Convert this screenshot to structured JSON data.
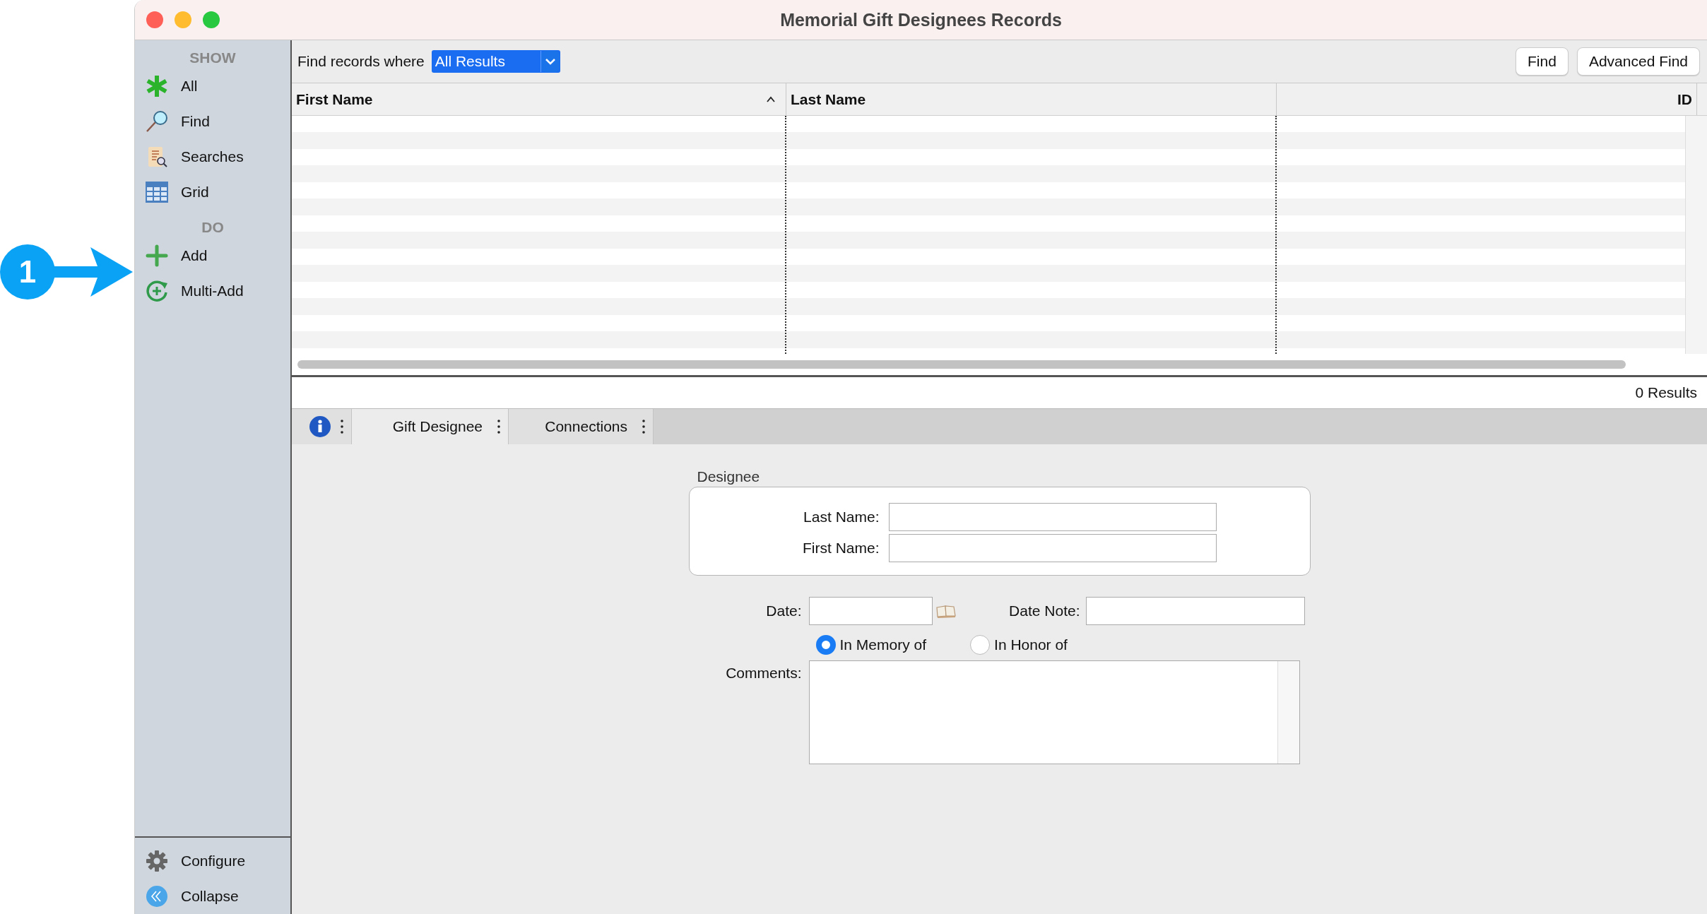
{
  "annotation": {
    "number": "1"
  },
  "window": {
    "title": "Memorial Gift Designees Records"
  },
  "sidebar": {
    "sections": [
      {
        "heading": "SHOW",
        "items": [
          {
            "label": "All",
            "kind": "asterisk"
          },
          {
            "label": "Find",
            "kind": "magnifier"
          },
          {
            "label": "Searches",
            "kind": "scroll"
          },
          {
            "label": "Grid",
            "kind": "grid"
          }
        ]
      },
      {
        "heading": "DO",
        "items": [
          {
            "label": "Add",
            "kind": "plus"
          },
          {
            "label": "Multi-Add",
            "kind": "multi"
          }
        ]
      }
    ],
    "footer": [
      {
        "label": "Configure",
        "kind": "gear"
      },
      {
        "label": "Collapse",
        "kind": "collapse"
      }
    ]
  },
  "toolbar": {
    "filter_label": "Find records where",
    "filter_value": "All Results",
    "buttons": [
      "Find",
      "Advanced Find"
    ]
  },
  "table": {
    "columns": [
      {
        "label": "First Name",
        "sorted": true
      },
      {
        "label": "Last Name",
        "sorted": false
      },
      {
        "label": "ID",
        "sorted": false
      }
    ]
  },
  "results": "0 Results",
  "tabs": [
    {
      "kind": "info",
      "selected": false
    },
    {
      "kind": "text",
      "label": "Gift Designee",
      "selected": true
    },
    {
      "kind": "text",
      "label": "Connections",
      "selected": false
    }
  ],
  "form": {
    "group_title": "Designee",
    "last_name_label": "Last Name:",
    "first_name_label": "First Name:",
    "date_label": "Date:",
    "date_note_label": "Date Note:",
    "radios": [
      {
        "label": "In Memory of",
        "selected": true
      },
      {
        "label": "In Honor of",
        "selected": false
      }
    ],
    "comments_label": "Comments:"
  }
}
